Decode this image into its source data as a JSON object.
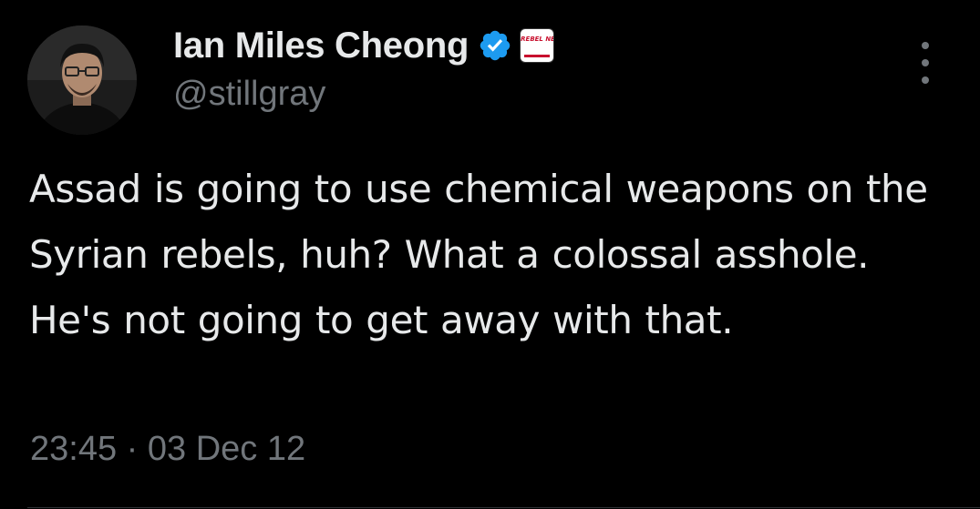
{
  "tweet": {
    "author": {
      "display_name": "Ian Miles Cheong",
      "handle": "@stillgray",
      "verified_icon": "verified-badge-icon",
      "affiliate_badge_text": "REBEL NEWS"
    },
    "text": "Assad is going to use chemical weapons on the Syrian rebels, huh? What a colossal asshole. He's not going to get away with that.",
    "timestamp": "23:45 · 03 Dec 12"
  },
  "colors": {
    "background": "#000000",
    "primary_text": "#e7e9ea",
    "secondary_text": "#71767b",
    "verified_blue": "#1d9bf0",
    "brand_red": "#c8102e"
  }
}
